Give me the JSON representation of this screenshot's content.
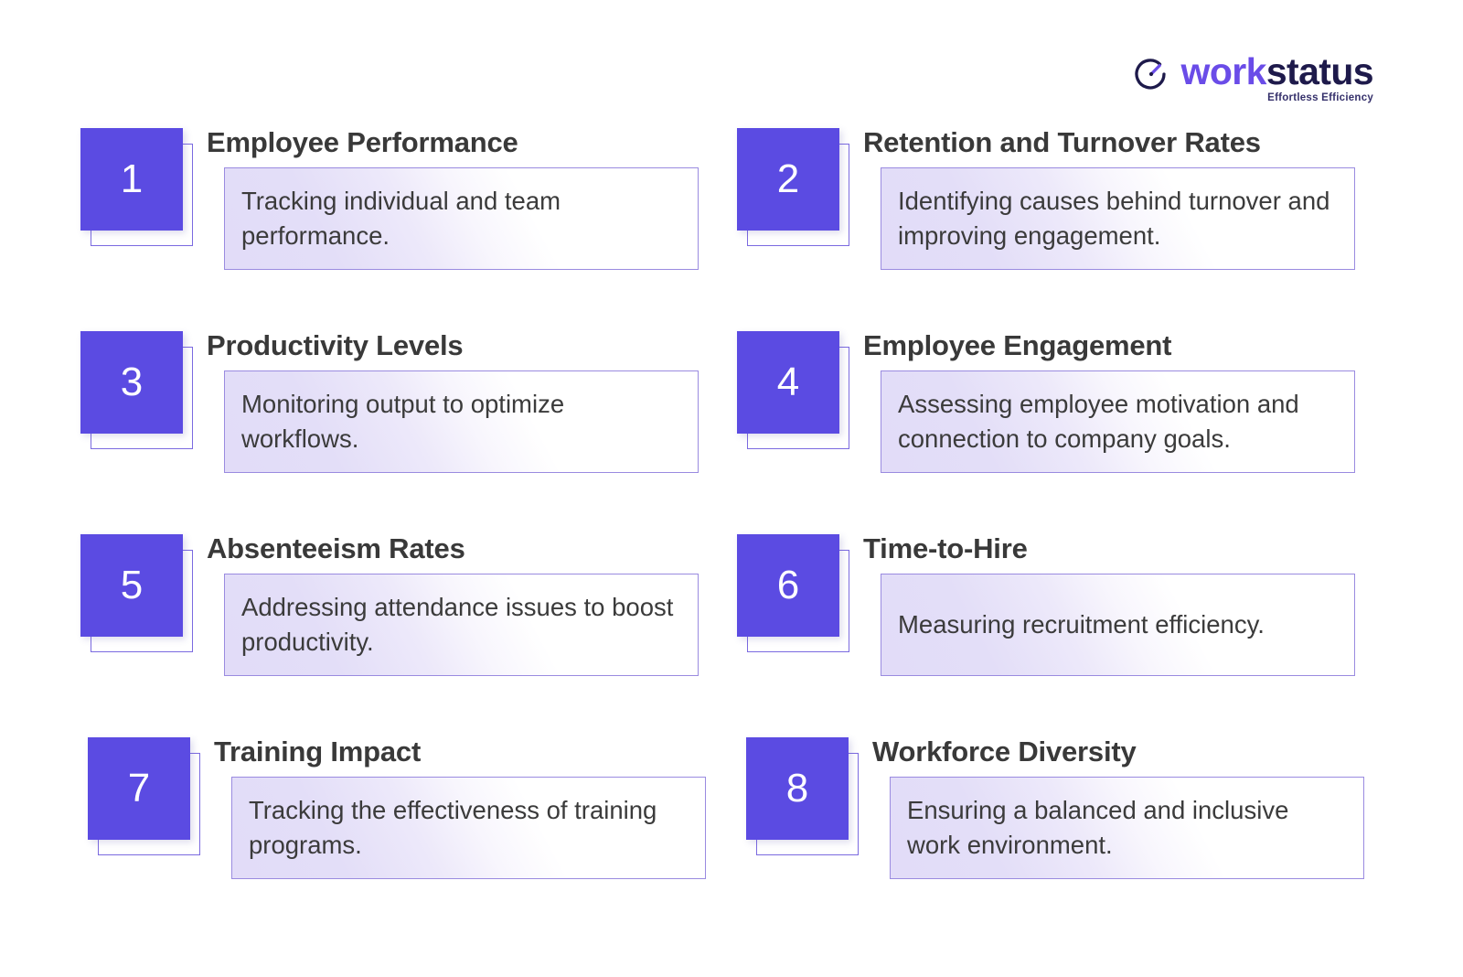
{
  "logo": {
    "icon": "stopwatch-timer-icon",
    "word_part_1": "work",
    "word_part_2": "status",
    "tagline": "Effortless Efficiency",
    "colors": {
      "work": "#6A4CE8",
      "status": "#1E1A4B",
      "tagline": "#35306B"
    }
  },
  "theme": {
    "accent_purple": "#5B4BE2",
    "border_purple": "#9A8BE0",
    "lavender": "#E3DEF8",
    "title_text": "#393939",
    "body_text": "#3B3B3B",
    "background": "#FFFFFF"
  },
  "items": [
    {
      "number": "1",
      "title": "Employee Performance",
      "description": "Tracking individual and team performance."
    },
    {
      "number": "2",
      "title": "Retention and Turnover Rates",
      "description": "Identifying causes behind turnover and improving engagement."
    },
    {
      "number": "3",
      "title": "Productivity Levels",
      "description": "Monitoring output to optimize workflows."
    },
    {
      "number": "4",
      "title": "Employee Engagement",
      "description": "Assessing employee motivation and connection to company goals."
    },
    {
      "number": "5",
      "title": "Absenteeism Rates",
      "description": "Addressing attendance issues to boost productivity."
    },
    {
      "number": "6",
      "title": "Time-to-Hire",
      "description": "Measuring recruitment efficiency."
    },
    {
      "number": "7",
      "title": "Training Impact",
      "description": "Tracking the effectiveness of training programs."
    },
    {
      "number": "8",
      "title": "Workforce Diversity",
      "description": "Ensuring a balanced and inclusive work environment."
    }
  ]
}
